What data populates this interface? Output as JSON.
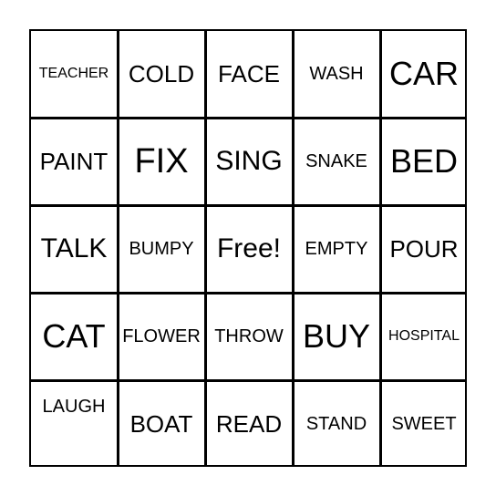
{
  "board": {
    "rows": [
      [
        {
          "text": "TEACHER",
          "size": "xs"
        },
        {
          "text": "COLD",
          "size": "md"
        },
        {
          "text": "FACE",
          "size": "md"
        },
        {
          "text": "WASH",
          "size": "sm"
        },
        {
          "text": "CAR",
          "size": "xl"
        }
      ],
      [
        {
          "text": "PAINT",
          "size": "md"
        },
        {
          "text": "FIX",
          "size": "xxl"
        },
        {
          "text": "SING",
          "size": "lg"
        },
        {
          "text": "SNAKE",
          "size": "sm"
        },
        {
          "text": "BED",
          "size": "xl"
        }
      ],
      [
        {
          "text": "TALK",
          "size": "lg"
        },
        {
          "text": "BUMPY",
          "size": "sm"
        },
        {
          "text": "Free!",
          "size": "lg"
        },
        {
          "text": "EMPTY",
          "size": "sm"
        },
        {
          "text": "POUR",
          "size": "md"
        }
      ],
      [
        {
          "text": "CAT",
          "size": "xl"
        },
        {
          "text": "FLOWER",
          "size": "sm"
        },
        {
          "text": "THROW",
          "size": "sm"
        },
        {
          "text": "BUY",
          "size": "xl"
        },
        {
          "text": "HOSPITAL",
          "size": "xs"
        }
      ],
      [
        {
          "text": "LAUGH",
          "size": "sm",
          "raised": true
        },
        {
          "text": "BOAT",
          "size": "md"
        },
        {
          "text": "READ",
          "size": "md"
        },
        {
          "text": "STAND",
          "size": "sm"
        },
        {
          "text": "SWEET",
          "size": "sm"
        }
      ]
    ]
  }
}
